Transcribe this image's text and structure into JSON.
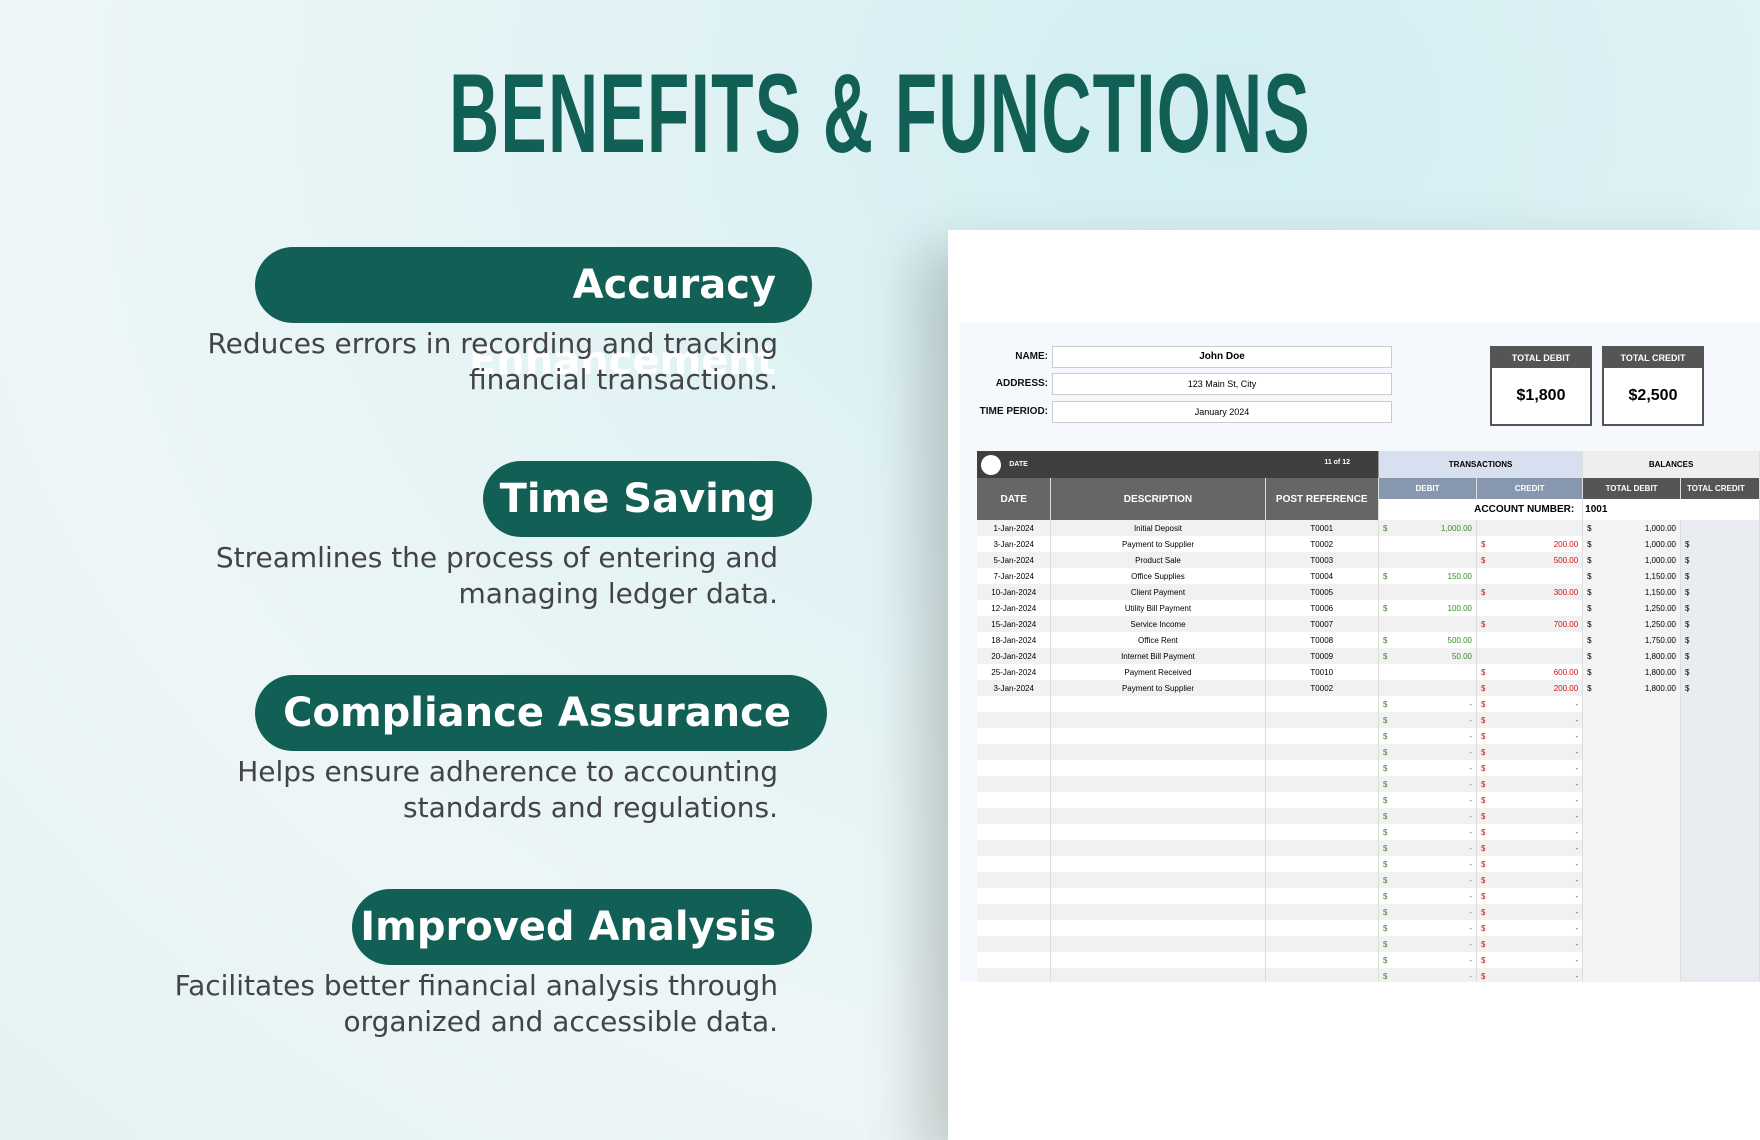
{
  "title": "BENEFITS & FUNCTIONS",
  "benefits": [
    {
      "label": "Accuracy Enhancement",
      "desc1": "Reduces errors in recording and tracking",
      "desc2": "financial transactions."
    },
    {
      "label": "Time Saving",
      "desc1": "Streamlines the process of entering and",
      "desc2": "managing ledger data."
    },
    {
      "label": "Compliance Assurance",
      "desc1": "Helps ensure adherence to accounting",
      "desc2": "standards and regulations."
    },
    {
      "label": "Improved Analysis",
      "desc1": "Facilitates better financial analysis through",
      "desc2": "organized and accessible data."
    }
  ],
  "sheet": {
    "name_label": "NAME:",
    "name": "John Doe",
    "address_label": "ADDRESS:",
    "address": "123 Main St, City",
    "period_label": "TIME PERIOD:",
    "period": "January 2024",
    "total_debit_label": "TOTAL DEBIT",
    "total_debit": "$1,800",
    "total_credit_label": "TOTAL CREDIT",
    "total_credit": "$2,500",
    "date_slider_label": "DATE",
    "date_slider_value": "11 of 12",
    "transactions": "TRANSACTIONS",
    "balances": "BALANCES",
    "headers": {
      "date": "DATE",
      "description": "DESCRIPTION",
      "post_ref": "POST REFERENCE",
      "debit": "DEBIT",
      "credit": "CREDIT",
      "total_debit": "TOTAL DEBIT",
      "total_credit": "TOTAL CREDIT"
    },
    "account_label": "ACCOUNT NUMBER:",
    "account_number": "1001",
    "currency": "$",
    "empty": "-",
    "rows": [
      [
        "1-Jan-2024",
        "Initial Deposit",
        "T0001",
        "1,000.00",
        "",
        "1,000.00"
      ],
      [
        "3-Jan-2024",
        "Payment to Supplier",
        "T0002",
        "",
        "200.00",
        "1,000.00"
      ],
      [
        "5-Jan-2024",
        "Product Sale",
        "T0003",
        "",
        "500.00",
        "1,000.00"
      ],
      [
        "7-Jan-2024",
        "Office Supplies",
        "T0004",
        "150.00",
        "",
        "1,150.00"
      ],
      [
        "10-Jan-2024",
        "Client Payment",
        "T0005",
        "",
        "300.00",
        "1,150.00"
      ],
      [
        "12-Jan-2024",
        "Utility Bill Payment",
        "T0006",
        "100.00",
        "",
        "1,250.00"
      ],
      [
        "15-Jan-2024",
        "Service Income",
        "T0007",
        "",
        "700.00",
        "1,250.00"
      ],
      [
        "18-Jan-2024",
        "Office Rent",
        "T0008",
        "500.00",
        "",
        "1,750.00"
      ],
      [
        "20-Jan-2024",
        "Internet Bill Payment",
        "T0009",
        "50.00",
        "",
        "1,800.00"
      ],
      [
        "25-Jan-2024",
        "Payment Received",
        "T0010",
        "",
        "600.00",
        "1,800.00"
      ],
      [
        "3-Jan-2024",
        "Payment to Supplier",
        "T0002",
        "",
        "200.00",
        "1,800.00"
      ]
    ],
    "empty_rows": 18
  }
}
